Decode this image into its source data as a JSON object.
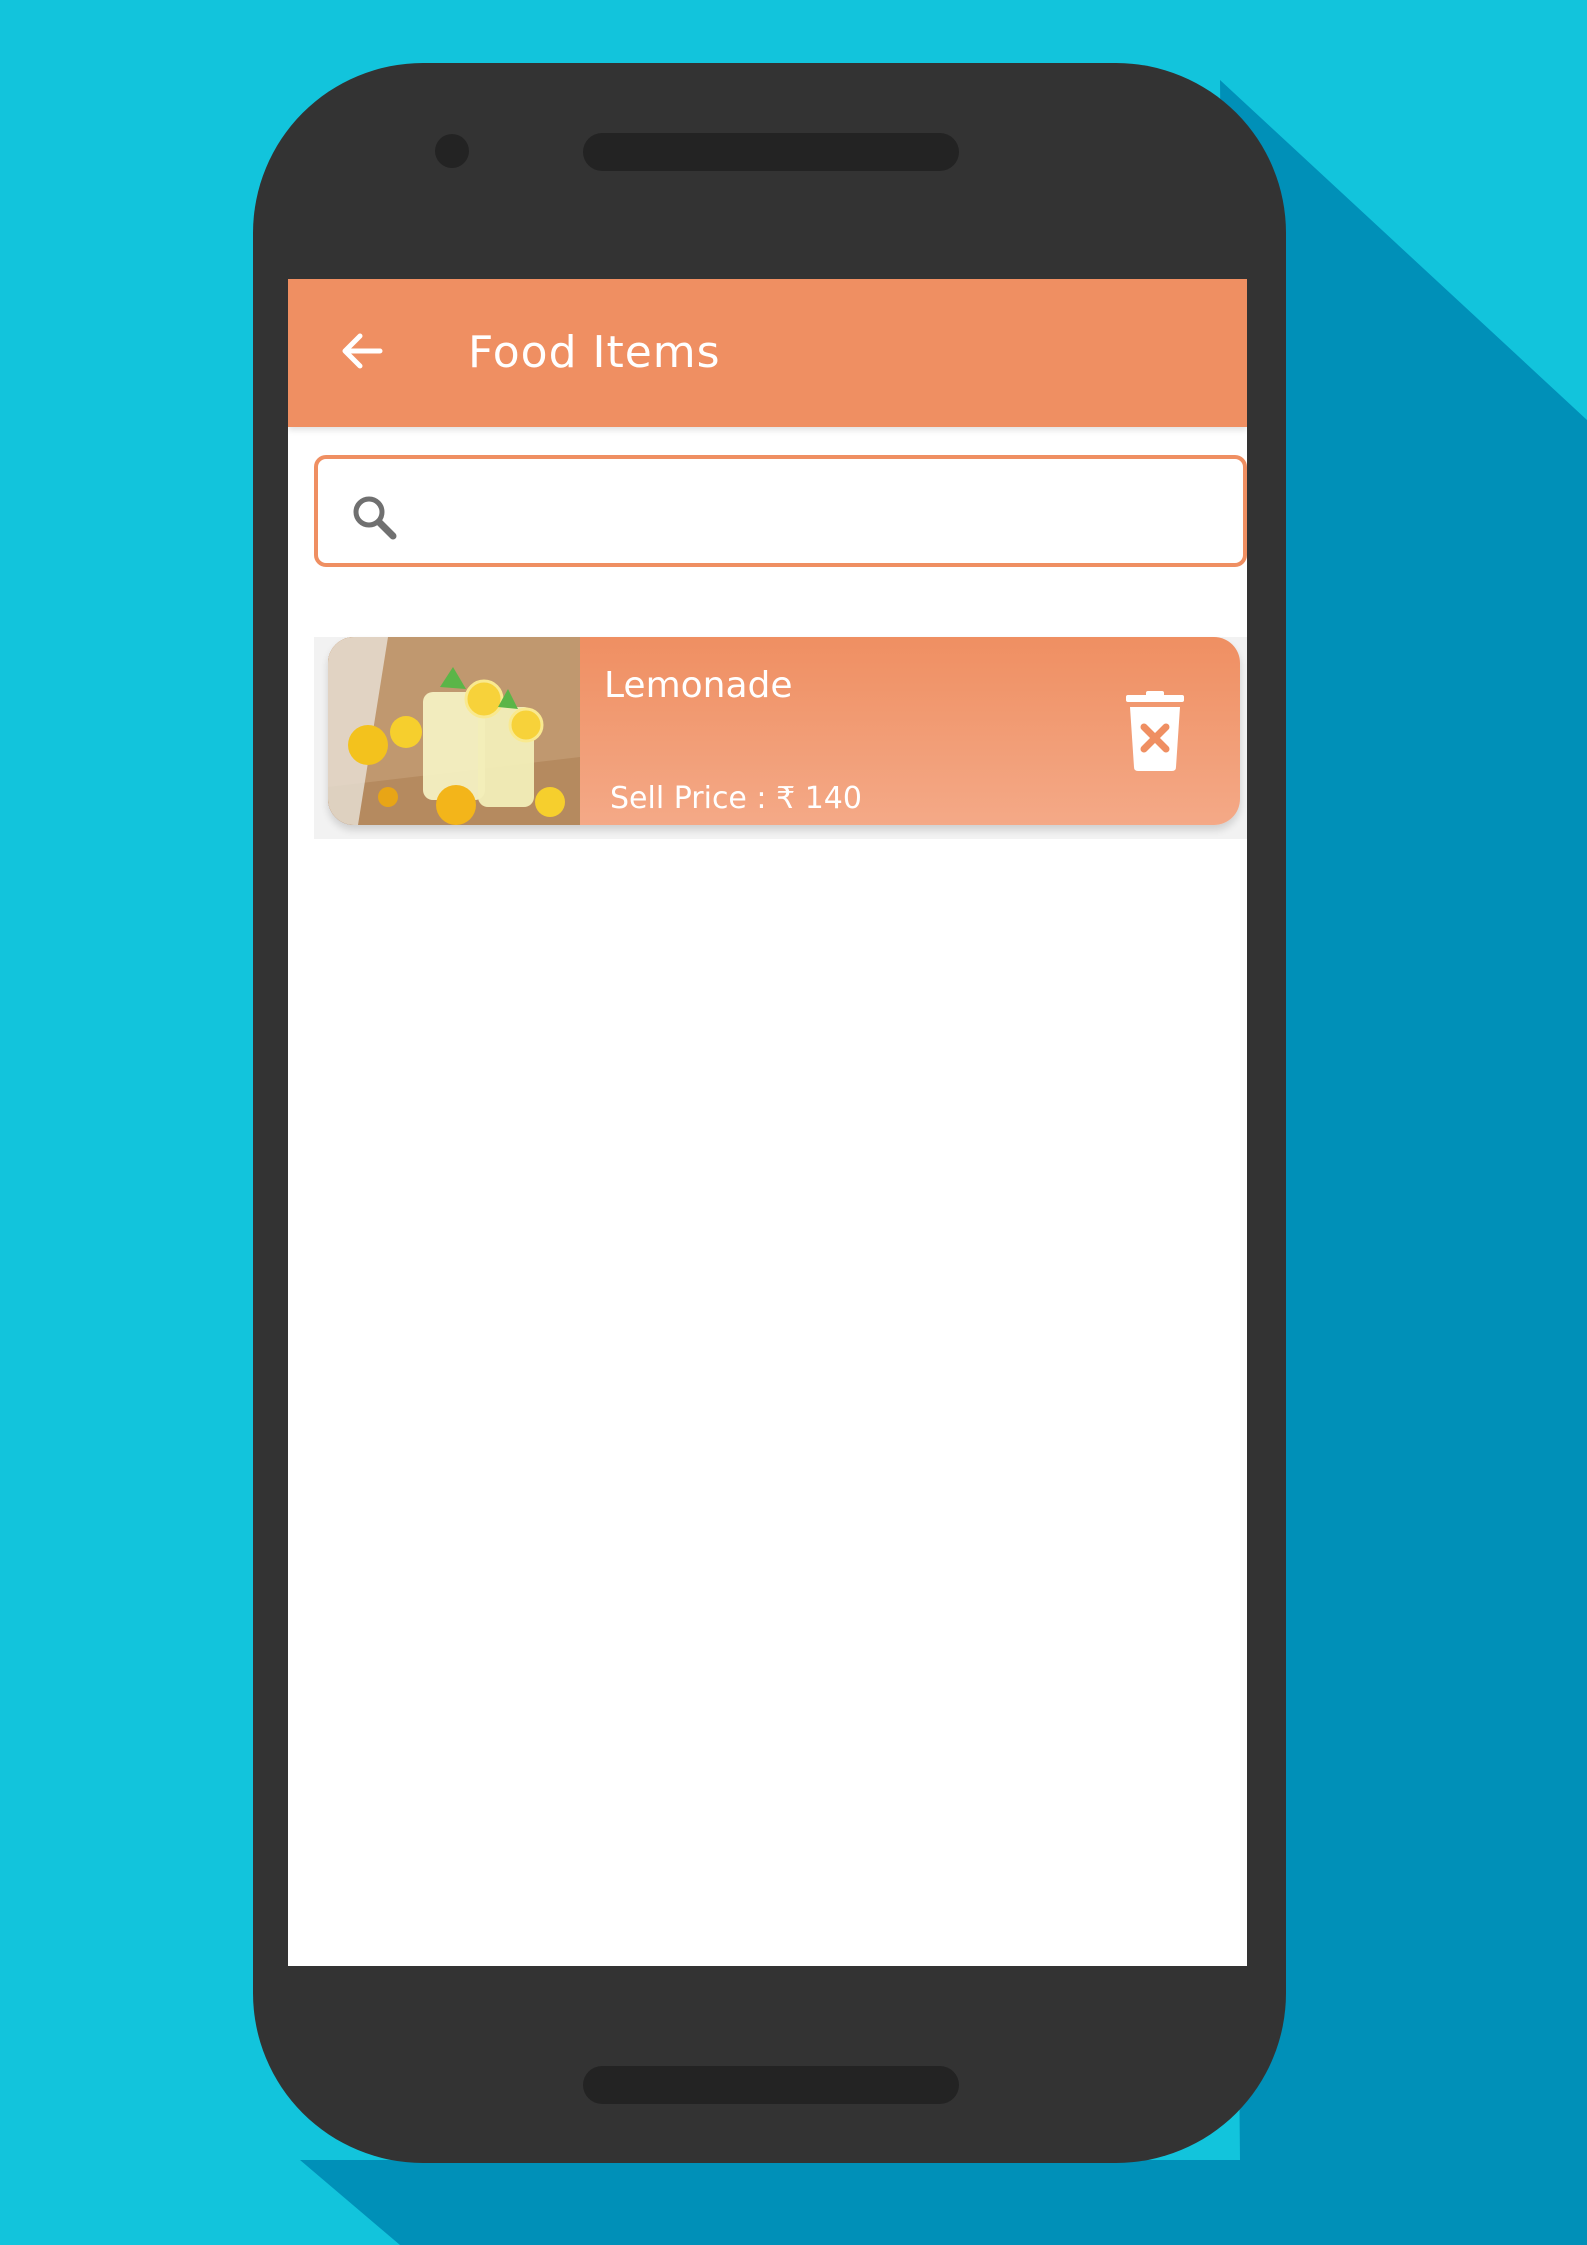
{
  "app_bar": {
    "title": "Food Items",
    "background_color": "#ef8f62"
  },
  "search": {
    "placeholder": "",
    "value": "",
    "border_color": "#ef8f62"
  },
  "food_items": [
    {
      "name": "Lemonade",
      "price_label": "Sell Price : ₹ 140",
      "image": "lemonade-photo"
    }
  ],
  "icons": {
    "back": "arrow-back-icon",
    "search": "search-icon",
    "delete": "delete-icon"
  }
}
